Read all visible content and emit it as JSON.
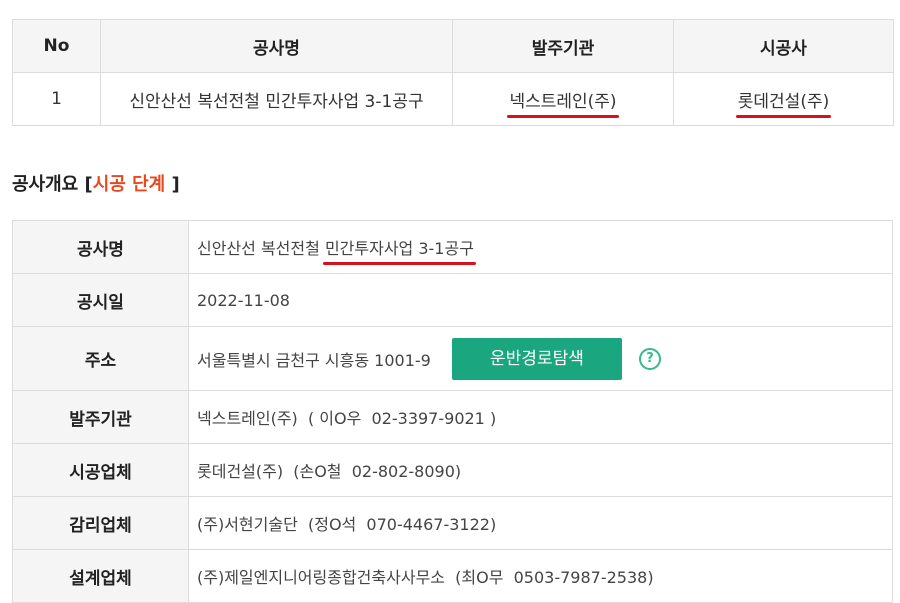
{
  "summary": {
    "headers": [
      "No",
      "공사명",
      "발주기관",
      "시공사"
    ],
    "row": {
      "no": "1",
      "project": "신안산선 복선전철 민간투자사업 3-1공구",
      "client": "넥스트레인(주)",
      "contractor": "롯데건설(주)"
    }
  },
  "section": {
    "title_prefix": "공사개요 [",
    "stage": "시공 단계",
    "title_suffix": " ]"
  },
  "details": {
    "project_label": "공사명",
    "project_part1": "신안산선 복선전철",
    "project_part2": "민간투자사업 3-1공구",
    "date_label": "공시일",
    "date_value": "2022-11-08",
    "address_label": "주소",
    "address_value": "서울특별시 금천구 시흥동 1001-9",
    "route_button": "운반경로탐색",
    "help_icon": "?",
    "client_label": "발주기관",
    "client_value": "넥스트레인(주)  ( 이O우  02-3397-9021 )",
    "contractor_label": "시공업체",
    "contractor_value": "롯데건설(주)  (손O철  02-802-8090)",
    "supervisor_label": "감리업체",
    "supervisor_value": "(주)서현기술단  (정O석  070-4467-3122)",
    "designer_label": "설계업체",
    "designer_value": "(주)제일엔지니어링종합건축사사무소  (최O무  0503-7987-2538)"
  },
  "colors": {
    "accent_red": "#e8481f",
    "underline_red": "#d6121f",
    "button_green": "#1aa77f",
    "header_bg": "#f5f5f5",
    "border": "#dcdcdc"
  }
}
